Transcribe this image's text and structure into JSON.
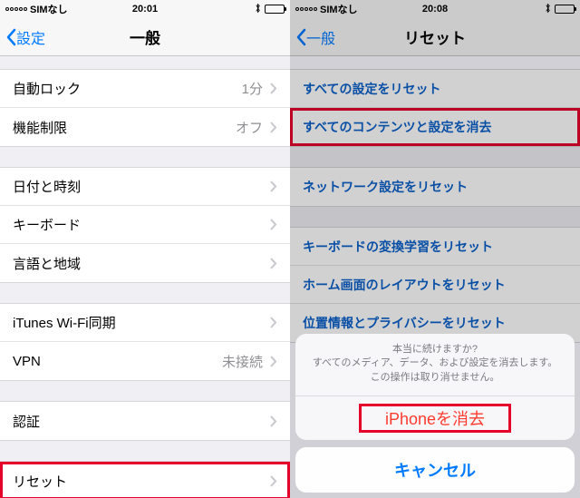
{
  "left": {
    "status": {
      "carrier": "SIMなし",
      "time": "20:01"
    },
    "nav": {
      "back": "設定",
      "title": "一般"
    },
    "groups": [
      [
        {
          "label": "自動ロック",
          "value": "1分"
        },
        {
          "label": "機能制限",
          "value": "オフ"
        }
      ],
      [
        {
          "label": "日付と時刻",
          "value": ""
        },
        {
          "label": "キーボード",
          "value": ""
        },
        {
          "label": "言語と地域",
          "value": ""
        }
      ],
      [
        {
          "label": "iTunes Wi-Fi同期",
          "value": ""
        },
        {
          "label": "VPN",
          "value": "未接続"
        }
      ],
      [
        {
          "label": "認証",
          "value": ""
        }
      ],
      [
        {
          "label": "リセット",
          "value": ""
        }
      ]
    ]
  },
  "right": {
    "status": {
      "carrier": "SIMなし",
      "time": "20:08"
    },
    "nav": {
      "back": "一般",
      "title": "リセット"
    },
    "items": [
      "すべての設定をリセット",
      "すべてのコンテンツと設定を消去",
      "ネットワーク設定をリセット",
      "キーボードの変換学習をリセット",
      "ホーム画面のレイアウトをリセット",
      "位置情報とプライバシーをリセット"
    ],
    "sheet": {
      "line1": "本当に続けますか?",
      "line2": "すべてのメディア、データ、および設定を消去します。この操作は取り消せません。",
      "erase": "iPhoneを消去",
      "cancel": "キャンセル"
    }
  }
}
